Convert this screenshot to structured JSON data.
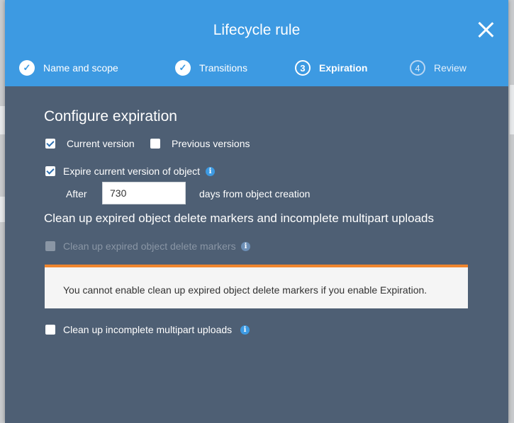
{
  "modal": {
    "title": "Lifecycle rule"
  },
  "steps": [
    {
      "label": "Name and scope",
      "marker": "done"
    },
    {
      "label": "Transitions",
      "marker": "done"
    },
    {
      "label": "Expiration",
      "marker": "3",
      "active": true
    },
    {
      "label": "Review",
      "marker": "4"
    }
  ],
  "expiration": {
    "heading": "Configure expiration",
    "current_version_label": "Current version",
    "previous_versions_label": "Previous versions",
    "expire_current_label": "Expire current version of object",
    "after_label": "After",
    "days_value": "730",
    "days_suffix": "days from object creation"
  },
  "cleanup": {
    "heading": "Clean up expired object delete markers and incomplete multipart uploads",
    "delete_markers_label": "Clean up expired object delete markers",
    "alert_text": "You cannot enable clean up expired object delete markers if you enable Expiration.",
    "multipart_label": "Clean up incomplete multipart uploads"
  },
  "colors": {
    "header": "#3d9ae2",
    "body": "#4e5f74",
    "alert_border": "#f0862e"
  }
}
